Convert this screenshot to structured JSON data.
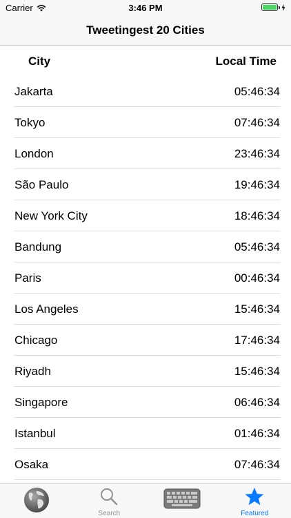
{
  "status_bar": {
    "carrier": "Carrier",
    "time": "3:46 PM"
  },
  "nav": {
    "title": "Tweetingest 20 Cities"
  },
  "table": {
    "headers": {
      "city": "City",
      "local_time": "Local Time"
    },
    "rows": [
      {
        "city": "Jakarta",
        "time": "05:46:34"
      },
      {
        "city": "Tokyo",
        "time": "07:46:34"
      },
      {
        "city": "London",
        "time": "23:46:34"
      },
      {
        "city": "São Paulo",
        "time": "19:46:34"
      },
      {
        "city": "New York City",
        "time": "18:46:34"
      },
      {
        "city": "Bandung",
        "time": "05:46:34"
      },
      {
        "city": "Paris",
        "time": "00:46:34"
      },
      {
        "city": "Los Angeles",
        "time": "15:46:34"
      },
      {
        "city": "Chicago",
        "time": "17:46:34"
      },
      {
        "city": "Riyadh",
        "time": "15:46:34"
      },
      {
        "city": "Singapore",
        "time": "06:46:34"
      },
      {
        "city": "Istanbul",
        "time": "01:46:34"
      },
      {
        "city": "Osaka",
        "time": "07:46:34"
      }
    ]
  },
  "tabs": [
    {
      "icon": "globe-icon",
      "label": ""
    },
    {
      "icon": "search-icon",
      "label": "Search"
    },
    {
      "icon": "keyboard-icon",
      "label": ""
    },
    {
      "icon": "star-icon",
      "label": "Featured",
      "active": true
    }
  ],
  "colors": {
    "accent": "#0a7aff",
    "battery": "#4cd964",
    "separator": "#dedede",
    "bar_background": "#f7f7f7"
  }
}
